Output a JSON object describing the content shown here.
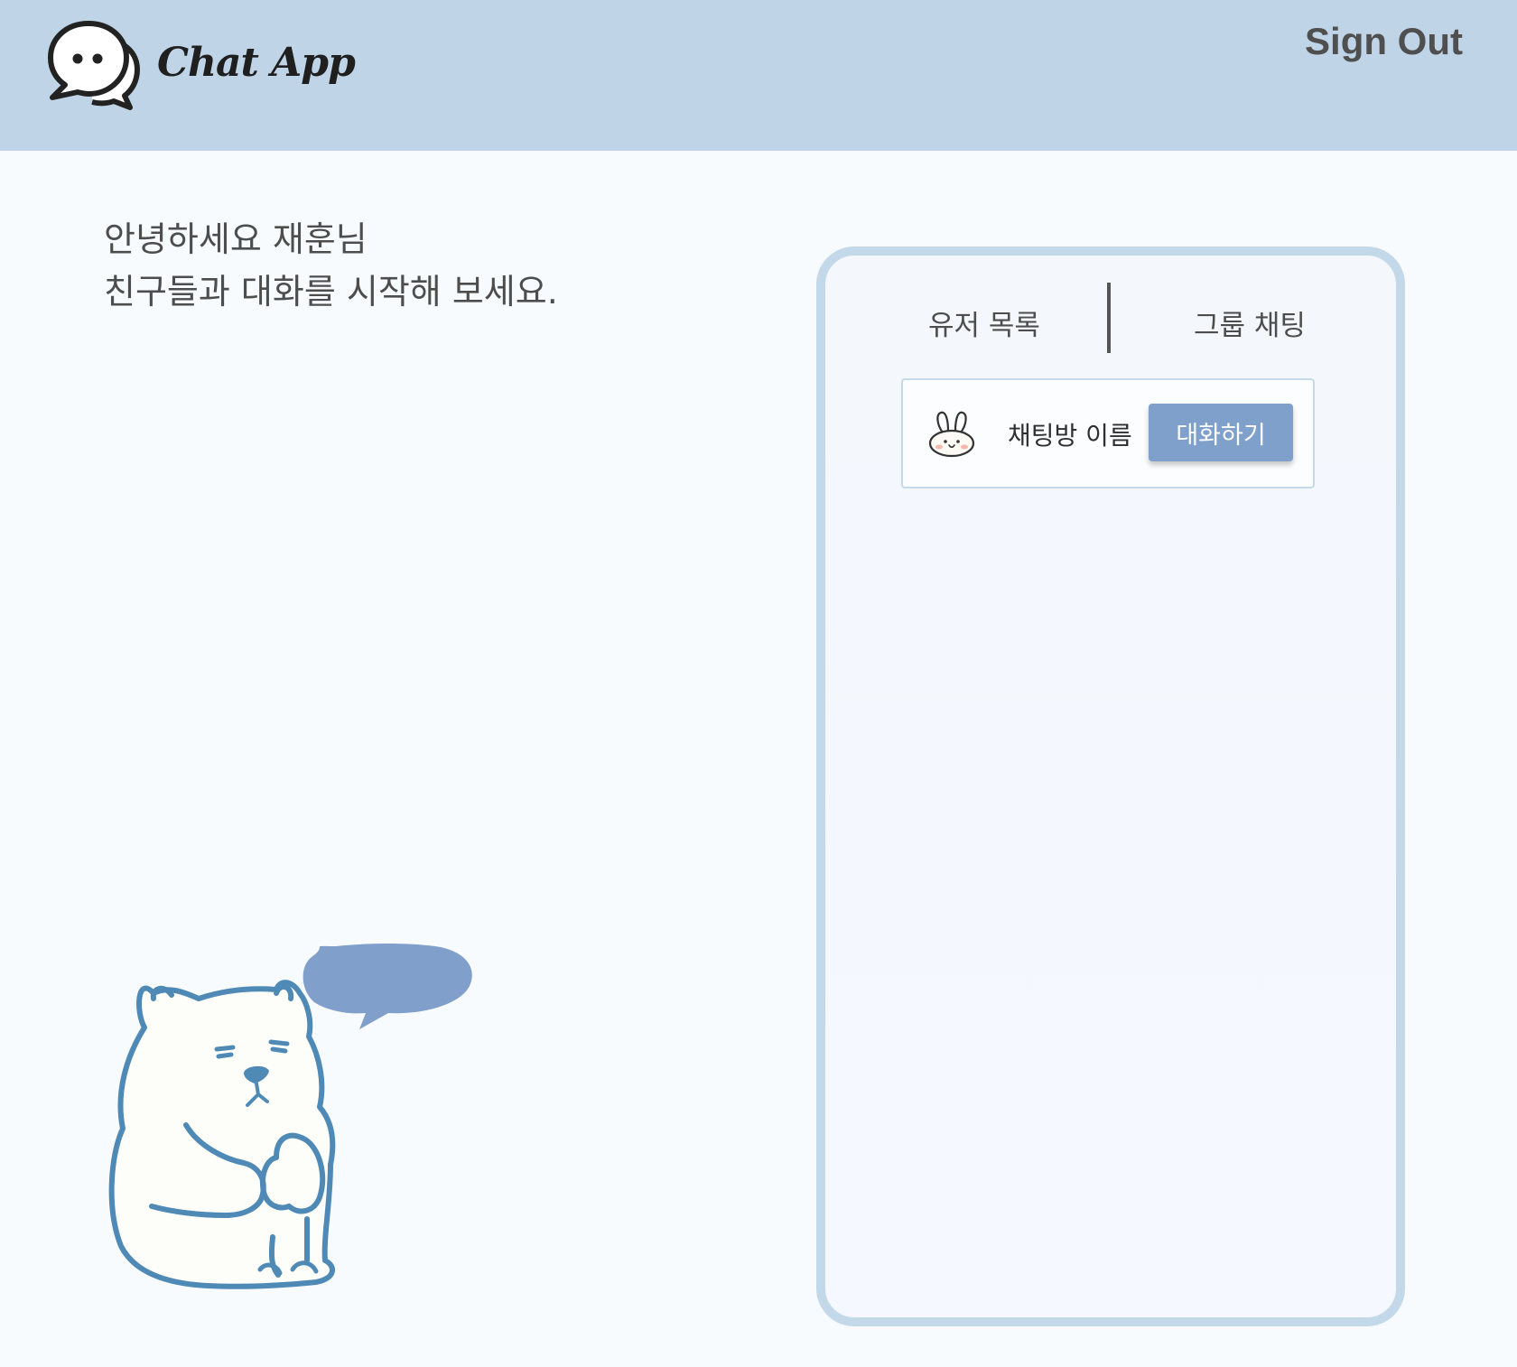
{
  "header": {
    "logo_text": "Chat App",
    "sign_out_label": "Sign Out"
  },
  "greeting": {
    "line1": "안녕하세요 재훈님",
    "line2": "친구들과 대화를 시작해 보세요."
  },
  "panel": {
    "tabs": [
      {
        "label": "유저 목록"
      },
      {
        "label": "그룹 채팅"
      }
    ],
    "rooms": [
      {
        "name": "채팅방 이름",
        "button_label": "대화하기",
        "avatar": "bunny-icon"
      }
    ]
  },
  "colors": {
    "header_bg": "#bfd5e7",
    "page_bg": "#f7fbfd",
    "panel_border": "#c3d8e8",
    "button_bg": "#7fa0cb",
    "bear_outline": "#4f8ab7",
    "speech_bubble": "#819fcb"
  }
}
